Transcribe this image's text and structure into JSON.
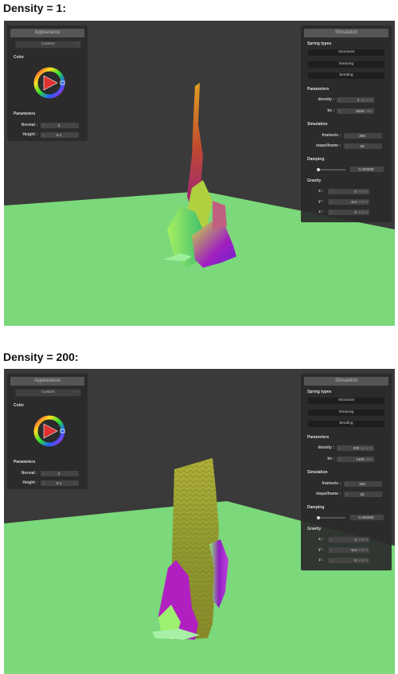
{
  "captions": [
    "Density = 1:",
    "Density = 200:"
  ],
  "colors": {
    "floor": "#7bd87b",
    "background": "#3c3c3c",
    "panel": "#2a2a2a",
    "accent": "#e64040"
  },
  "appearance": {
    "title": "Appearance",
    "dropdown": "Custom",
    "color_label": "Color",
    "params_label": "Parameters",
    "normal_label": "Normal :",
    "normal_value": "2",
    "height_label": "Height :",
    "height_value": "0.1"
  },
  "simulation_labels": {
    "title": "Simulation",
    "spring_types": "Spring types",
    "structural": "structural",
    "shearing": "shearing",
    "bending": "bending",
    "parameters": "Parameters",
    "density_label": "density :",
    "density_unit": "g/cm^2",
    "ks_label": "ks :",
    "ks_unit": "N/m",
    "simulation": "Simulation",
    "fps_label": "frames/s :",
    "fps_value": "300",
    "steps_label": "steps/frame :",
    "steps_value": "30",
    "damping": "Damping",
    "damping_value": "0.200000",
    "gravity": "Gravity",
    "x_label": "x :",
    "y_label": "y :",
    "z_label": "z :",
    "gravity_unit": "m/s^2",
    "gx": "0",
    "gy": "-9.8",
    "gz": "0"
  },
  "panels": [
    {
      "density": "1",
      "ks": "5000",
      "damping_fraction": 0.05
    },
    {
      "density": "200",
      "ks": "1400",
      "damping_fraction": 0.05
    }
  ],
  "icons": [
    "color-wheel-icon",
    "chevron-down-icon",
    "slider-knob-icon"
  ]
}
